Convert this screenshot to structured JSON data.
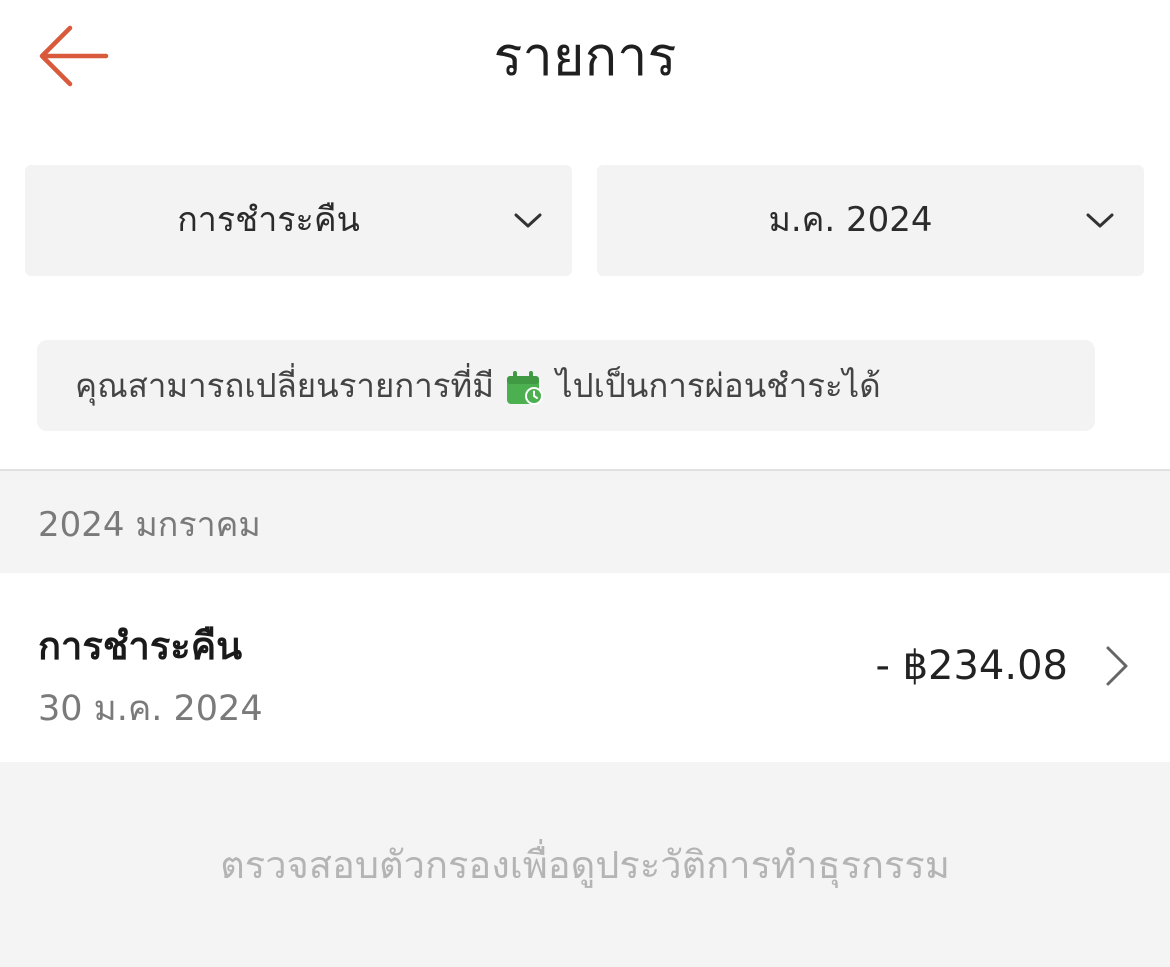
{
  "header": {
    "title": "รายการ",
    "back_icon": "arrow-left-icon",
    "accent_color": "#d95a3b"
  },
  "filters": {
    "type": {
      "value": "การชำระคืน",
      "icon": "chevron-down-icon"
    },
    "month": {
      "value": "ม.ค. 2024",
      "icon": "chevron-down-icon"
    }
  },
  "info_banner": {
    "text_before": "คุณสามารถเปลี่ยนรายการที่มี",
    "icon": "calendar-clock-icon",
    "icon_color": "#4caf50",
    "text_after": "ไปเป็นการผ่อนชำระได้"
  },
  "section": {
    "title": "2024 มกราคม"
  },
  "transactions": [
    {
      "title": "การชำระคืน",
      "date": "30 ม.ค. 2024",
      "amount": "- ฿234.08",
      "icon": "chevron-right-icon"
    }
  ],
  "hint": {
    "text": "ตรวจสอบตัวกรองเพื่อดูประวัติการทำธุรกรรม"
  }
}
